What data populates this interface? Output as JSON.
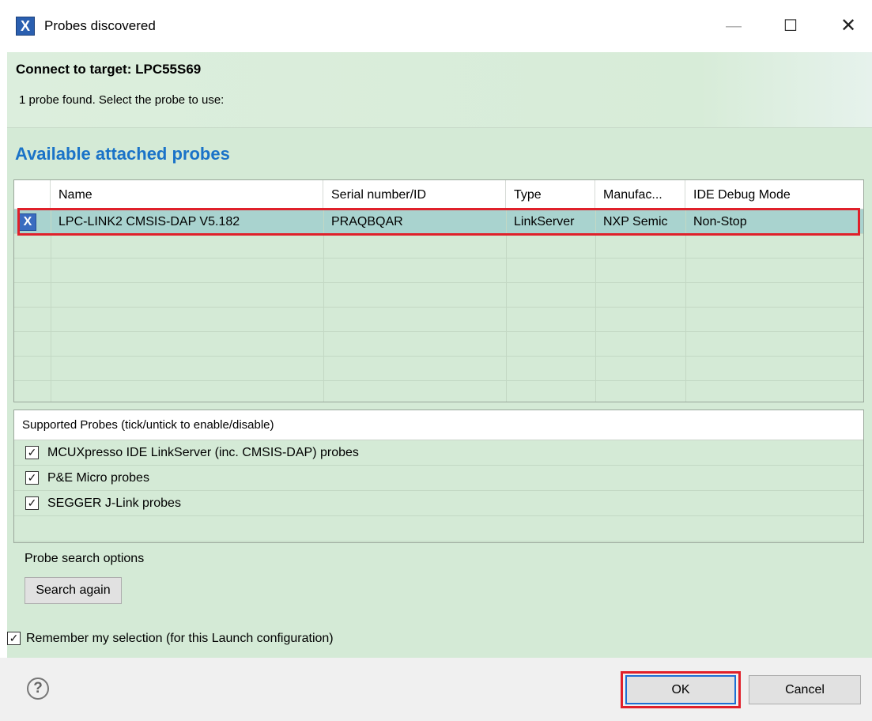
{
  "window": {
    "title": "Probes discovered",
    "icon": "x-app-icon",
    "controls": {
      "minimize": "—",
      "maximize": "☐",
      "close": "✕"
    }
  },
  "header": {
    "title": "Connect to target: LPC55S69",
    "message": "1 probe found. Select the probe to use:"
  },
  "section_title": "Available attached probes",
  "probe_table": {
    "columns": [
      "Name",
      "Serial number/ID",
      "Type",
      "Manufac...",
      "IDE Debug Mode"
    ],
    "rows": [
      {
        "name": "LPC-LINK2 CMSIS-DAP V5.182",
        "serial": "PRAQBQAR",
        "type": "LinkServer",
        "manufacturer": "NXP Semic",
        "mode": "Non-Stop",
        "selected": true
      }
    ]
  },
  "supported_probes": {
    "header": "Supported Probes (tick/untick to enable/disable)",
    "items": [
      {
        "label": "MCUXpresso IDE LinkServer (inc. CMSIS-DAP) probes",
        "checked": true
      },
      {
        "label": "P&E Micro probes",
        "checked": true
      },
      {
        "label": "SEGGER J-Link probes",
        "checked": true
      }
    ]
  },
  "search": {
    "legend": "Probe search options",
    "button_label": "Search again"
  },
  "remember": {
    "label": "Remember my selection (for this Launch configuration)",
    "checked": true
  },
  "footer": {
    "help": "?",
    "ok_label": "OK",
    "cancel_label": "Cancel"
  },
  "colors": {
    "panel_green": "#d4ead6",
    "selected_row": "#a9d3cf",
    "highlight_red": "#e0202a",
    "section_title_blue": "#1a73c8"
  }
}
